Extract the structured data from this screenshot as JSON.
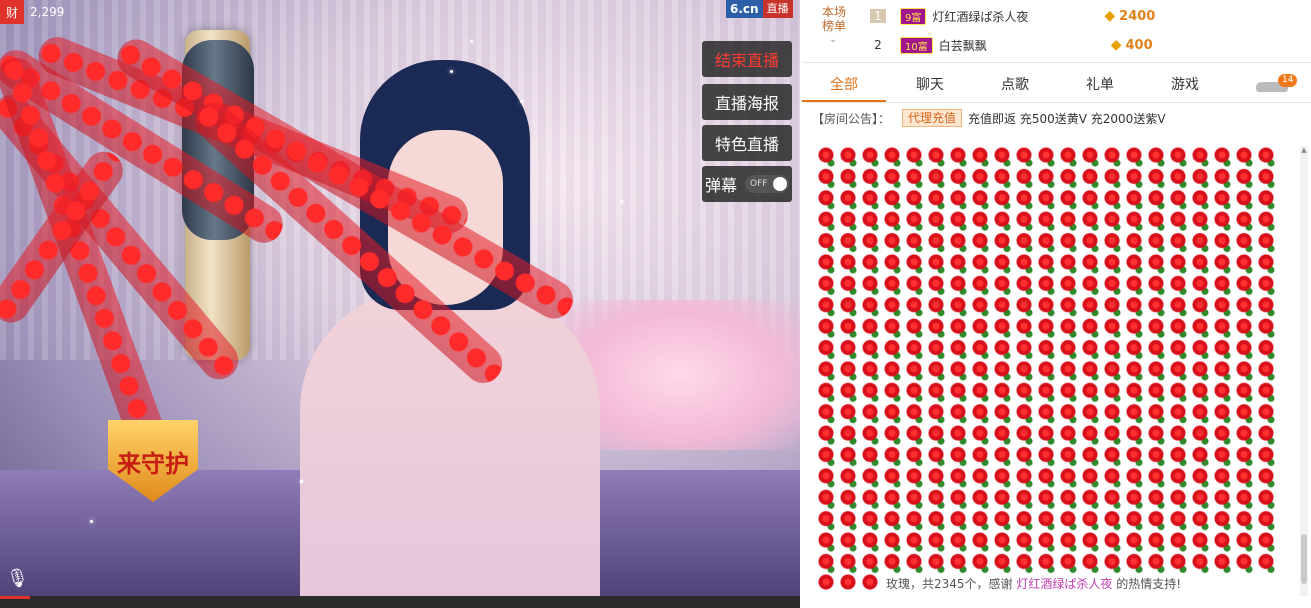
{
  "video": {
    "viewer_badge": "财",
    "viewer_count": "2,299",
    "logo_main": "6.cn",
    "logo_tag": "直播",
    "buttons": {
      "end_live": "结束直播",
      "poster": "直播海报",
      "featured": "特色直播",
      "danmaku": "弹幕",
      "danmaku_state": "OFF"
    },
    "shield_text": "来守护"
  },
  "ranking": {
    "title": "本场榜单",
    "rows": [
      {
        "rank": "1",
        "level": "9富",
        "name": "灯红酒绿ぱ杀人夜",
        "amount": "2400"
      },
      {
        "rank": "2",
        "level": "10富",
        "name": "白芸飘飘",
        "amount": "400"
      }
    ]
  },
  "tabs": [
    {
      "label": "全部",
      "active": true
    },
    {
      "label": "聊天",
      "active": false
    },
    {
      "label": "点歌",
      "active": false
    },
    {
      "label": "礼单",
      "active": false
    },
    {
      "label": "游戏",
      "active": false
    }
  ],
  "car_badge_count": "14",
  "notice": {
    "label": "【房间公告】：",
    "agent_button": "代理充值",
    "text": "充值即返 充500送黄V 充2000送紫V"
  },
  "gift_message": {
    "prefix": "玫瑰，共2345个，感谢 ",
    "user": "灯红酒绿ぱ杀人夜",
    "suffix": " 的热情支持!"
  },
  "colors": {
    "accent": "#e0731a",
    "live_red": "#e0312b",
    "gold": "#e0831a"
  }
}
